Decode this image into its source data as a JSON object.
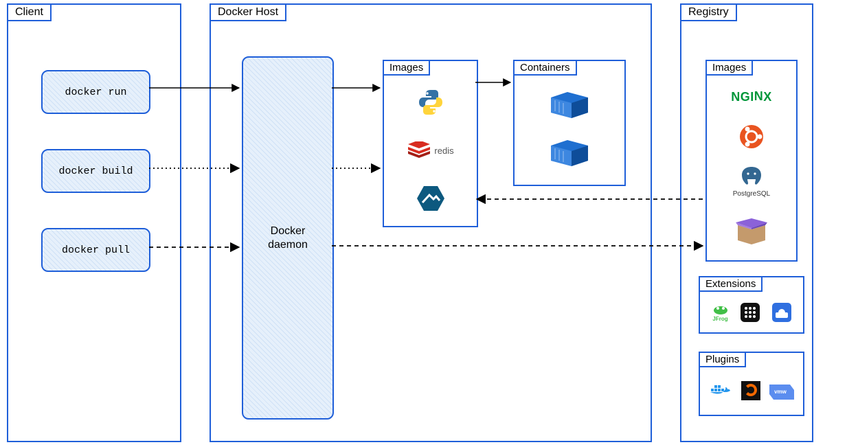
{
  "panels": {
    "client": {
      "title": "Client"
    },
    "host": {
      "title": "Docker Host"
    },
    "registry": {
      "title": "Registry"
    }
  },
  "client_cmds": [
    "docker run",
    "docker build",
    "docker pull"
  ],
  "daemon_label": "Docker\ndaemon",
  "host_boxes": {
    "images": "Images",
    "containers": "Containers"
  },
  "host_images_icons": [
    "python",
    "redis",
    "alpine"
  ],
  "host_containers_count": 2,
  "registry_boxes": {
    "images": "Images",
    "extensions": "Extensions",
    "plugins": "Plugins"
  },
  "registry_images_icons": [
    "nginx",
    "ubuntu",
    "postgresql",
    "box"
  ],
  "registry_extensions_icons": [
    "jfrog",
    "grid-app",
    "cloud-app"
  ],
  "registry_plugins_icons": [
    "docker",
    "grafana",
    "vmware"
  ],
  "arrows": {
    "run_to_daemon": {
      "style": "solid"
    },
    "build_to_daemon": {
      "style": "dotted"
    },
    "pull_to_daemon": {
      "style": "dashed"
    },
    "daemon_to_images": {
      "style": "solid"
    },
    "daemon_to_images2": {
      "style": "dotted"
    },
    "images_to_containers": {
      "style": "solid"
    },
    "registry_to_images": {
      "style": "dashed"
    },
    "daemon_to_registry": {
      "style": "dashed"
    }
  },
  "colors": {
    "border": "#1f5fd9",
    "fill": "#e6f0fb",
    "python_blue": "#3572A5",
    "python_yellow": "#FFD43B",
    "redis": "#D82C20",
    "alpine": "#0D597F",
    "container": "#1f6fd0",
    "nginx": "#009639",
    "ubuntu": "#E95420",
    "postgres": "#336791",
    "jfrog": "#41bf47",
    "docker": "#2496ED",
    "grafana": "#F46800",
    "vmware": "#5b8def"
  }
}
